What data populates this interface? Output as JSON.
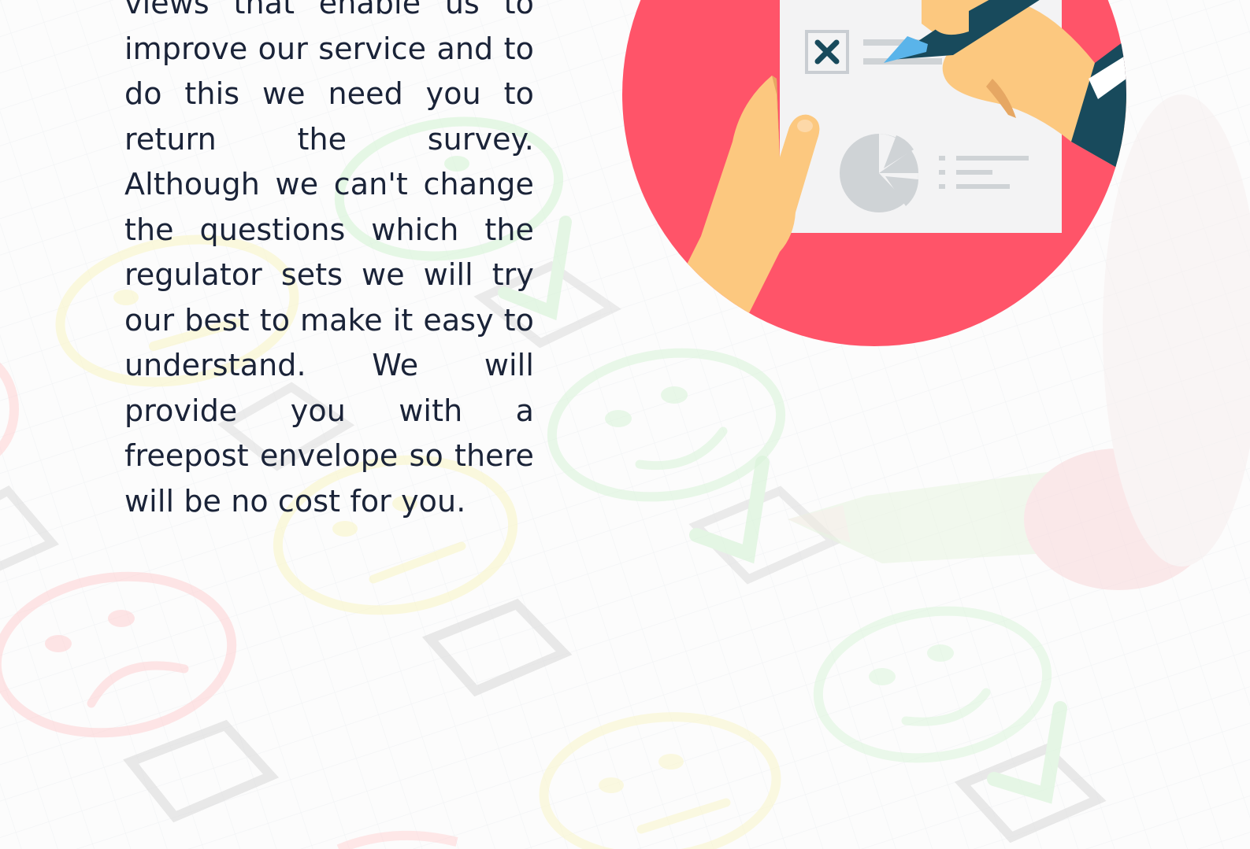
{
  "body_text": "views that enable us to improve our service and to do this we need you to return the survey. Although we can't change the questions which the regulator sets we will try our best to make it easy to understand. We will provide you with a freepost envelope so there will be no cost for you.",
  "colors": {
    "text": "#1a2338",
    "circle": "#ff5469",
    "skin": "#fcc87f",
    "navy": "#184a5c",
    "pen_tip": "#5ab4ea",
    "paper": "#f3f3f4",
    "chart_gray": "#cfd3d6",
    "happy": "#b8efb8",
    "neutral": "#f8f1a6",
    "sad": "#ffb3b6",
    "checkbox": "#cfcfcf"
  },
  "icons": [
    "survey-form-illustration",
    "pie-chart-icon",
    "close-x-icon",
    "pencil-icon",
    "smiley-happy-icon",
    "smiley-neutral-icon",
    "smiley-sad-icon",
    "checkbox-icon",
    "checkmark-icon"
  ]
}
